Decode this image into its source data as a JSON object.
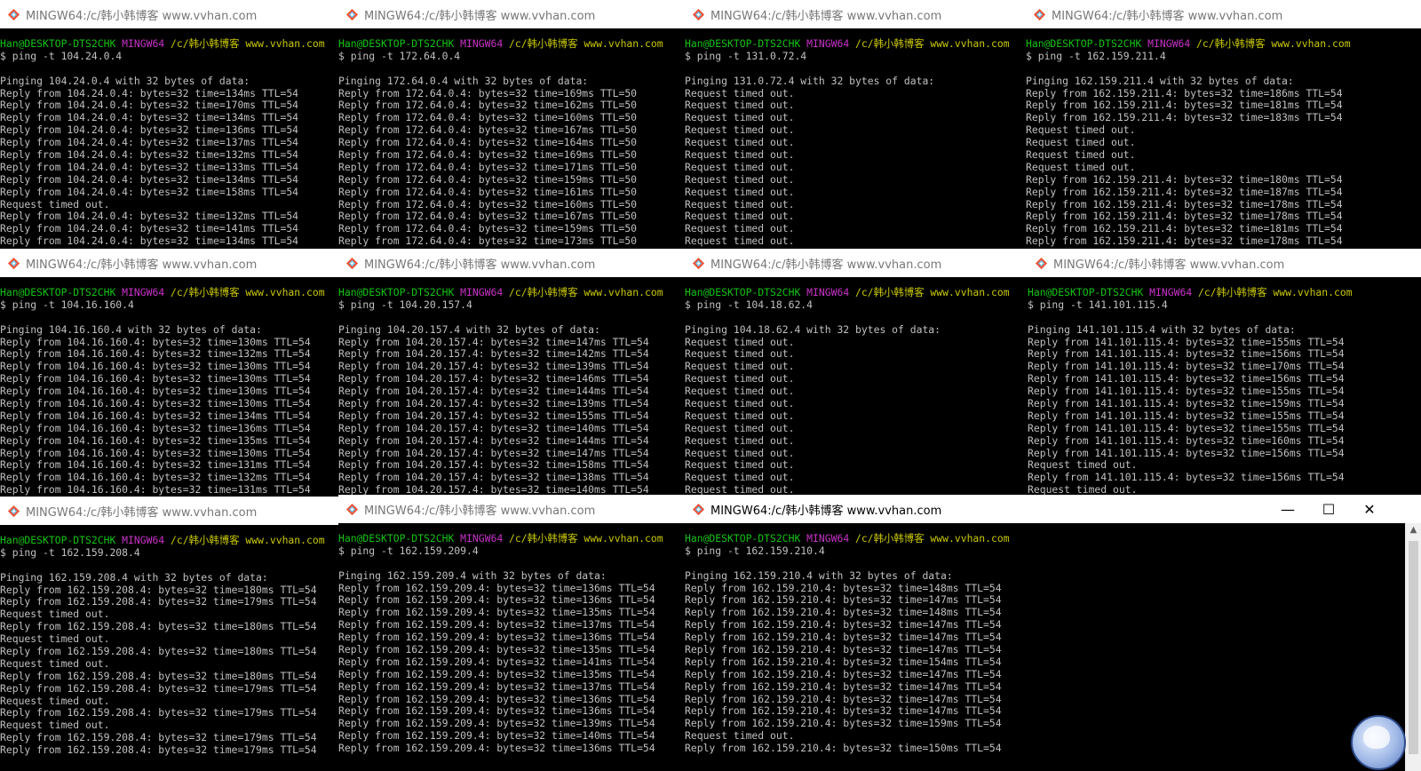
{
  "window_title": "MINGW64:/c/韩小韩博客 www.vvhan.com",
  "prompt": {
    "user_host": "Han@DESKTOP-DTS2CHK",
    "shell": "MINGW64",
    "path": "/c/韩小韩博客 www.vvhan.com"
  },
  "window_controls": {
    "minimize": "—",
    "maximize": "☐",
    "close": "✕"
  },
  "scrollbar": {
    "up_arrow": "▲"
  },
  "terminals": [
    {
      "command": "$ ping -t 104.24.0.4",
      "lines": [
        "",
        "Pinging 104.24.0.4 with 32 bytes of data:",
        "Reply from 104.24.0.4: bytes=32 time=134ms TTL=54",
        "Reply from 104.24.0.4: bytes=32 time=170ms TTL=54",
        "Reply from 104.24.0.4: bytes=32 time=134ms TTL=54",
        "Reply from 104.24.0.4: bytes=32 time=136ms TTL=54",
        "Reply from 104.24.0.4: bytes=32 time=137ms TTL=54",
        "Reply from 104.24.0.4: bytes=32 time=132ms TTL=54",
        "Reply from 104.24.0.4: bytes=32 time=133ms TTL=54",
        "Reply from 104.24.0.4: bytes=32 time=134ms TTL=54",
        "Reply from 104.24.0.4: bytes=32 time=158ms TTL=54",
        "Request timed out.",
        "Reply from 104.24.0.4: bytes=32 time=132ms TTL=54",
        "Reply from 104.24.0.4: bytes=32 time=141ms TTL=54",
        "Reply from 104.24.0.4: bytes=32 time=134ms TTL=54"
      ]
    },
    {
      "command": "$ ping -t 172.64.0.4",
      "lines": [
        "",
        "Pinging 172.64.0.4 with 32 bytes of data:",
        "Reply from 172.64.0.4: bytes=32 time=169ms TTL=50",
        "Reply from 172.64.0.4: bytes=32 time=162ms TTL=50",
        "Reply from 172.64.0.4: bytes=32 time=160ms TTL=50",
        "Reply from 172.64.0.4: bytes=32 time=167ms TTL=50",
        "Reply from 172.64.0.4: bytes=32 time=164ms TTL=50",
        "Reply from 172.64.0.4: bytes=32 time=169ms TTL=50",
        "Reply from 172.64.0.4: bytes=32 time=171ms TTL=50",
        "Reply from 172.64.0.4: bytes=32 time=159ms TTL=50",
        "Reply from 172.64.0.4: bytes=32 time=161ms TTL=50",
        "Reply from 172.64.0.4: bytes=32 time=160ms TTL=50",
        "Reply from 172.64.0.4: bytes=32 time=167ms TTL=50",
        "Reply from 172.64.0.4: bytes=32 time=159ms TTL=50",
        "Reply from 172.64.0.4: bytes=32 time=173ms TTL=50"
      ]
    },
    {
      "command": "$ ping -t 131.0.72.4",
      "lines": [
        "",
        "Pinging 131.0.72.4 with 32 bytes of data:",
        "Request timed out.",
        "Request timed out.",
        "Request timed out.",
        "Request timed out.",
        "Request timed out.",
        "Request timed out.",
        "Request timed out.",
        "Request timed out.",
        "Request timed out.",
        "Request timed out.",
        "Request timed out.",
        "Request timed out.",
        "Request timed out."
      ]
    },
    {
      "command": "$ ping -t 162.159.211.4",
      "lines": [
        "",
        "Pinging 162.159.211.4 with 32 bytes of data:",
        "Reply from 162.159.211.4: bytes=32 time=186ms TTL=54",
        "Reply from 162.159.211.4: bytes=32 time=181ms TTL=54",
        "Reply from 162.159.211.4: bytes=32 time=183ms TTL=54",
        "Request timed out.",
        "Request timed out.",
        "Request timed out.",
        "Request timed out.",
        "Reply from 162.159.211.4: bytes=32 time=180ms TTL=54",
        "Reply from 162.159.211.4: bytes=32 time=187ms TTL=54",
        "Reply from 162.159.211.4: bytes=32 time=178ms TTL=54",
        "Reply from 162.159.211.4: bytes=32 time=178ms TTL=54",
        "Reply from 162.159.211.4: bytes=32 time=181ms TTL=54",
        "Reply from 162.159.211.4: bytes=32 time=178ms TTL=54"
      ]
    },
    {
      "command": "$ ping -t 104.16.160.4",
      "lines": [
        "",
        "Pinging 104.16.160.4 with 32 bytes of data:",
        "Reply from 104.16.160.4: bytes=32 time=130ms TTL=54",
        "Reply from 104.16.160.4: bytes=32 time=132ms TTL=54",
        "Reply from 104.16.160.4: bytes=32 time=130ms TTL=54",
        "Reply from 104.16.160.4: bytes=32 time=130ms TTL=54",
        "Reply from 104.16.160.4: bytes=32 time=130ms TTL=54",
        "Reply from 104.16.160.4: bytes=32 time=130ms TTL=54",
        "Reply from 104.16.160.4: bytes=32 time=134ms TTL=54",
        "Reply from 104.16.160.4: bytes=32 time=136ms TTL=54",
        "Reply from 104.16.160.4: bytes=32 time=135ms TTL=54",
        "Reply from 104.16.160.4: bytes=32 time=130ms TTL=54",
        "Reply from 104.16.160.4: bytes=32 time=131ms TTL=54",
        "Reply from 104.16.160.4: bytes=32 time=132ms TTL=54",
        "Reply from 104.16.160.4: bytes=32 time=131ms TTL=54"
      ]
    },
    {
      "command": "$ ping -t 104.20.157.4",
      "lines": [
        "",
        "Pinging 104.20.157.4 with 32 bytes of data:",
        "Reply from 104.20.157.4: bytes=32 time=147ms TTL=54",
        "Reply from 104.20.157.4: bytes=32 time=142ms TTL=54",
        "Reply from 104.20.157.4: bytes=32 time=139ms TTL=54",
        "Reply from 104.20.157.4: bytes=32 time=146ms TTL=54",
        "Reply from 104.20.157.4: bytes=32 time=144ms TTL=54",
        "Reply from 104.20.157.4: bytes=32 time=139ms TTL=54",
        "Reply from 104.20.157.4: bytes=32 time=155ms TTL=54",
        "Reply from 104.20.157.4: bytes=32 time=140ms TTL=54",
        "Reply from 104.20.157.4: bytes=32 time=144ms TTL=54",
        "Reply from 104.20.157.4: bytes=32 time=147ms TTL=54",
        "Reply from 104.20.157.4: bytes=32 time=158ms TTL=54",
        "Reply from 104.20.157.4: bytes=32 time=138ms TTL=54",
        "Reply from 104.20.157.4: bytes=32 time=140ms TTL=54"
      ]
    },
    {
      "command": "$ ping -t 104.18.62.4",
      "lines": [
        "",
        "Pinging 104.18.62.4 with 32 bytes of data:",
        "Request timed out.",
        "Request timed out.",
        "Request timed out.",
        "Request timed out.",
        "Request timed out.",
        "Request timed out.",
        "Request timed out.",
        "Request timed out.",
        "Request timed out.",
        "Request timed out.",
        "Request timed out.",
        "Request timed out.",
        "Request timed out."
      ]
    },
    {
      "command": "$ ping -t 141.101.115.4",
      "lines": [
        "",
        "Pinging 141.101.115.4 with 32 bytes of data:",
        "Reply from 141.101.115.4: bytes=32 time=155ms TTL=54",
        "Reply from 141.101.115.4: bytes=32 time=156ms TTL=54",
        "Reply from 141.101.115.4: bytes=32 time=170ms TTL=54",
        "Reply from 141.101.115.4: bytes=32 time=156ms TTL=54",
        "Reply from 141.101.115.4: bytes=32 time=155ms TTL=54",
        "Reply from 141.101.115.4: bytes=32 time=159ms TTL=54",
        "Reply from 141.101.115.4: bytes=32 time=155ms TTL=54",
        "Reply from 141.101.115.4: bytes=32 time=155ms TTL=54",
        "Reply from 141.101.115.4: bytes=32 time=160ms TTL=54",
        "Reply from 141.101.115.4: bytes=32 time=156ms TTL=54",
        "Request timed out.",
        "Reply from 141.101.115.4: bytes=32 time=156ms TTL=54",
        "Request timed out."
      ]
    },
    {
      "command": "$ ping -t 162.159.208.4",
      "lines": [
        "",
        "Pinging 162.159.208.4 with 32 bytes of data:",
        "Reply from 162.159.208.4: bytes=32 time=180ms TTL=54",
        "Reply from 162.159.208.4: bytes=32 time=179ms TTL=54",
        "Request timed out.",
        "Reply from 162.159.208.4: bytes=32 time=180ms TTL=54",
        "Request timed out.",
        "Reply from 162.159.208.4: bytes=32 time=180ms TTL=54",
        "Request timed out.",
        "Reply from 162.159.208.4: bytes=32 time=180ms TTL=54",
        "Reply from 162.159.208.4: bytes=32 time=179ms TTL=54",
        "Request timed out.",
        "Reply from 162.159.208.4: bytes=32 time=179ms TTL=54",
        "Request timed out.",
        "Reply from 162.159.208.4: bytes=32 time=179ms TTL=54",
        "Reply from 162.159.208.4: bytes=32 time=179ms TTL=54"
      ]
    },
    {
      "command": "$ ping -t 162.159.209.4",
      "lines": [
        "",
        "Pinging 162.159.209.4 with 32 bytes of data:",
        "Reply from 162.159.209.4: bytes=32 time=136ms TTL=54",
        "Reply from 162.159.209.4: bytes=32 time=136ms TTL=54",
        "Reply from 162.159.209.4: bytes=32 time=135ms TTL=54",
        "Reply from 162.159.209.4: bytes=32 time=137ms TTL=54",
        "Reply from 162.159.209.4: bytes=32 time=136ms TTL=54",
        "Reply from 162.159.209.4: bytes=32 time=135ms TTL=54",
        "Reply from 162.159.209.4: bytes=32 time=141ms TTL=54",
        "Reply from 162.159.209.4: bytes=32 time=135ms TTL=54",
        "Reply from 162.159.209.4: bytes=32 time=137ms TTL=54",
        "Reply from 162.159.209.4: bytes=32 time=136ms TTL=54",
        "Reply from 162.159.209.4: bytes=32 time=136ms TTL=54",
        "Reply from 162.159.209.4: bytes=32 time=139ms TTL=54",
        "Reply from 162.159.209.4: bytes=32 time=140ms TTL=54",
        "Reply from 162.159.209.4: bytes=32 time=136ms TTL=54"
      ]
    },
    {
      "command": "$ ping -t 162.159.210.4",
      "lines": [
        "",
        "Pinging 162.159.210.4 with 32 bytes of data:",
        "Reply from 162.159.210.4: bytes=32 time=148ms TTL=54",
        "Reply from 162.159.210.4: bytes=32 time=147ms TTL=54",
        "Reply from 162.159.210.4: bytes=32 time=148ms TTL=54",
        "Reply from 162.159.210.4: bytes=32 time=147ms TTL=54",
        "Reply from 162.159.210.4: bytes=32 time=147ms TTL=54",
        "Reply from 162.159.210.4: bytes=32 time=147ms TTL=54",
        "Reply from 162.159.210.4: bytes=32 time=154ms TTL=54",
        "Reply from 162.159.210.4: bytes=32 time=147ms TTL=54",
        "Reply from 162.159.210.4: bytes=32 time=147ms TTL=54",
        "Reply from 162.159.210.4: bytes=32 time=147ms TTL=54",
        "Reply from 162.159.210.4: bytes=32 time=147ms TTL=54",
        "Reply from 162.159.210.4: bytes=32 time=159ms TTL=54",
        "Request timed out.",
        "Reply from 162.159.210.4: bytes=32 time=150ms TTL=54"
      ]
    }
  ]
}
